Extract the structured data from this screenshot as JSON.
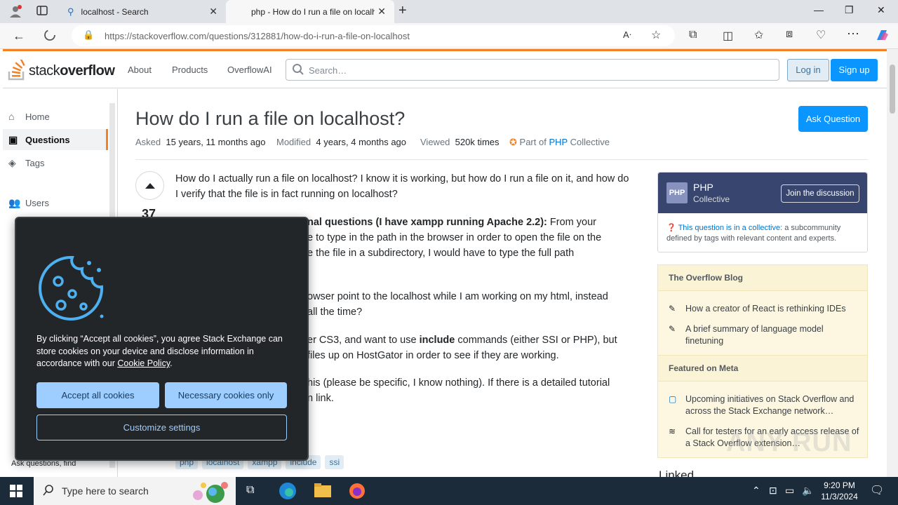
{
  "browser": {
    "tabs": [
      {
        "title": "localhost - Search"
      },
      {
        "title": "php - How do I run a file on localhost"
      }
    ],
    "url": "https://stackoverflow.com/questions/312881/how-do-i-run-a-file-on-localhost"
  },
  "header": {
    "logo_prefix": "stack",
    "logo_bold": "overflow",
    "nav": [
      "About",
      "Products",
      "OverflowAI"
    ],
    "search_placeholder": "Search…",
    "login": "Log in",
    "signup": "Sign up"
  },
  "leftnav": {
    "items": [
      {
        "label": "Home"
      },
      {
        "label": "Questions"
      },
      {
        "label": "Tags"
      },
      {
        "label": "Users"
      }
    ],
    "footer": "Ask questions, find"
  },
  "question": {
    "title": "How do I run a file on localhost?",
    "ask_button": "Ask Question",
    "asked_label": "Asked",
    "asked_value": "15 years, 11 months ago",
    "modified_label": "Modified",
    "modified_value": "4 years, 4 months ago",
    "viewed_label": "Viewed",
    "viewed_value": "520k times",
    "collective_prefix": "Part of",
    "collective_name": "PHP",
    "collective_suffix": "Collective",
    "votes": "37",
    "p1": "How do I actually run a file on localhost? I know it is working, but how do I run a file on it, and how do I verify that the file is in fact running on localhost?",
    "p2_bold": "nal questions (I have xampp running Apache 2.2):",
    "p2_rest": " From your",
    "p2_l2": "e to type in the path in the browser in order to open the file on the",
    "p2_l3": "e the file in a subdirectory, I would have to type the full path",
    "p3_l1": "owser point to the localhost while I am working on my html, instead",
    "p3_l2": "all the time?",
    "p4_a": "er CS3, and want to use ",
    "p4_bold": "include",
    "p4_b": " commands (either SSI or PHP), but",
    "p4_l2": "files up on HostGator in order to see if they are working.",
    "p5_l1": "his (please be specific, I know nothing). If there is a detailed tutorial",
    "p5_l2": "n link.",
    "tags": [
      "php",
      "localhost",
      "xampp",
      "include",
      "ssi"
    ]
  },
  "sidebar": {
    "collective_logo": "PHP",
    "collective_name": "PHP",
    "collective_sub": "Collective",
    "join": "Join the discussion",
    "desc_link": "This question is in a collective:",
    "desc_rest": " a subcommunity defined by tags with relevant content and experts.",
    "blog_title": "The Overflow Blog",
    "blog_items": [
      "How a creator of React is rethinking IDEs",
      "A brief summary of language model finetuning"
    ],
    "meta_title": "Featured on Meta",
    "meta_items": [
      "Upcoming initiatives on Stack Overflow and across the Stack Exchange network…",
      "Call for testers for an early access release of a Stack Overflow extension…"
    ],
    "linked": "Linked"
  },
  "cookie": {
    "text_a": "By clicking “Accept all cookies”, you agree Stack Exchange can store cookies on your device and disclose information in accordance with our ",
    "policy": "Cookie Policy",
    "text_b": ".",
    "accept": "Accept all cookies",
    "necessary": "Necessary cookies only",
    "customize": "Customize settings"
  },
  "taskbar": {
    "search_placeholder": "Type here to search",
    "time": "9:20 PM",
    "date": "11/3/2024"
  },
  "watermark": "ANY RUN",
  "colors": {
    "accent": "#f48225",
    "primary": "#0a95ff",
    "cookie_bg": "#232629"
  }
}
